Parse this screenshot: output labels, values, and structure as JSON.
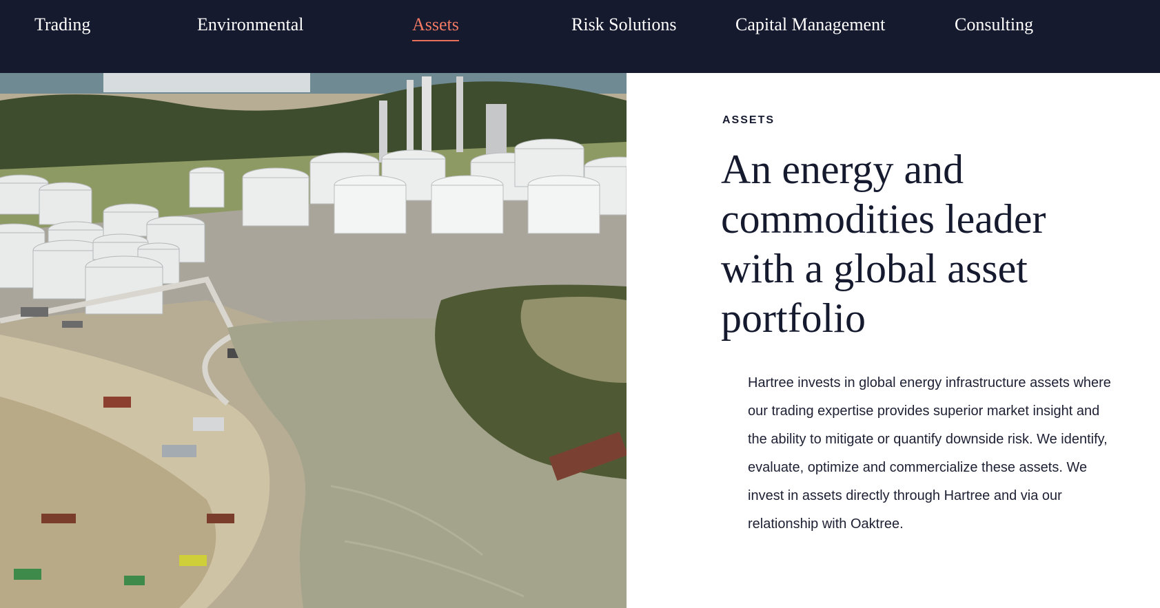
{
  "nav": {
    "items": [
      {
        "label": "Trading"
      },
      {
        "label": "Environmental"
      },
      {
        "label": "Assets"
      },
      {
        "label": "Risk Solutions"
      },
      {
        "label": "Capital Management"
      },
      {
        "label": "Consulting"
      }
    ],
    "active_index": 2
  },
  "content": {
    "eyebrow": "ASSETS",
    "headline": "An energy and commodities leader with a global asset portfolio",
    "body": "Hartree invests in global energy infrastructure assets where our trading expertise provides superior market insight and the ability to mitigate or quantify downside risk. We identify, evaluate, optimize and commercialize these assets. We invest in assets directly through Hartree and via our relationship with Oaktree."
  },
  "colors": {
    "nav_background": "#161a2f",
    "accent": "#f27a63",
    "text_dark": "#161a2f",
    "water": "#a4a48c"
  }
}
